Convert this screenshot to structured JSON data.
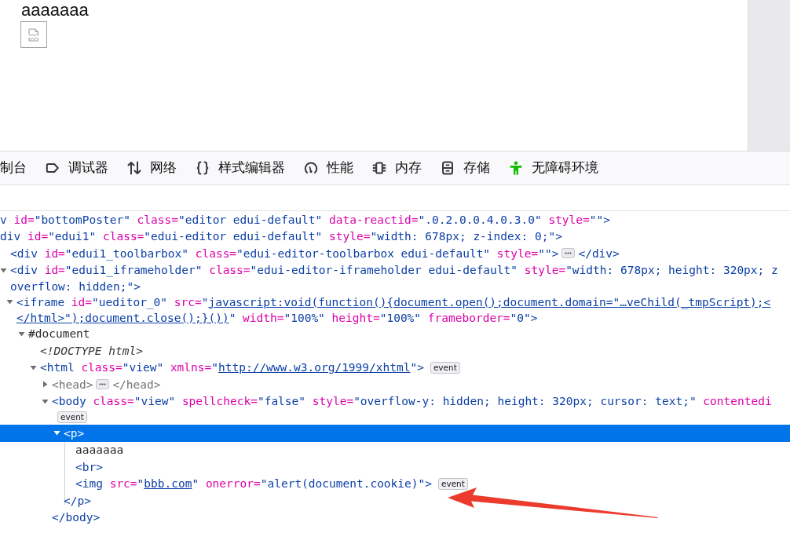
{
  "page_preview": {
    "paragraph": "aaaaaaa",
    "broken_image": true
  },
  "toolbar": {
    "tabs": [
      {
        "label": "制台",
        "selected": false
      },
      {
        "label": "调试器",
        "selected": false
      },
      {
        "label": "网络",
        "selected": false
      },
      {
        "label": "样式编辑器",
        "selected": false
      },
      {
        "label": "性能",
        "selected": false
      },
      {
        "label": "内存",
        "selected": false
      },
      {
        "label": "存储",
        "selected": false
      },
      {
        "label": "无障碍环境",
        "selected": false
      }
    ]
  },
  "tree": [
    {
      "selected": false,
      "lines": [
        [
          {
            "kind": "tag",
            "text": "v"
          },
          {
            "kind": "attr",
            "text": " id="
          },
          {
            "kind": "tag",
            "text": "\"bottomPoster\""
          },
          {
            "kind": "attr",
            "text": " class="
          },
          {
            "kind": "tag",
            "text": "\"editor edui-default\""
          },
          {
            "kind": "attr",
            "text": " data-reactid="
          },
          {
            "kind": "tag",
            "text": "\".0.2.0.0.4.0.3.0\""
          },
          {
            "kind": "attr",
            "text": " style="
          },
          {
            "kind": "tag",
            "text": "\"\">"
          }
        ]
      ],
      "children": [
        {
          "selected": false,
          "lines": [
            [
              {
                "kind": "tag",
                "text": "div"
              },
              {
                "kind": "attr",
                "text": " id="
              },
              {
                "kind": "tag",
                "text": "\"edui1\""
              },
              {
                "kind": "attr",
                "text": " class="
              },
              {
                "kind": "tag",
                "text": "\"edui-editor edui-default\""
              },
              {
                "kind": "attr",
                "text": " style="
              },
              {
                "kind": "tag",
                "text": "\"width: 678px; z-index: 0;\">"
              }
            ]
          ],
          "children": [
            {
              "selected": false,
              "lines": [
                [
                  {
                    "kind": "tag",
                    "text": "<div"
                  },
                  {
                    "kind": "attr",
                    "text": " id="
                  },
                  {
                    "kind": "tag",
                    "text": "\"edui1_toolbarbox\""
                  },
                  {
                    "kind": "attr",
                    "text": " class="
                  },
                  {
                    "kind": "tag",
                    "text": "\"edui-editor-toolbarbox edui-default\""
                  },
                  {
                    "kind": "attr",
                    "text": " style="
                  },
                  {
                    "kind": "tag",
                    "text": "\"\">"
                  },
                  {
                    "kind": "more"
                  },
                  {
                    "kind": "tag",
                    "text": "</div>"
                  }
                ]
              ]
            },
            {
              "selected": false,
              "expanded": true,
              "lines": [
                [
                  {
                    "kind": "tag",
                    "text": "<div"
                  },
                  {
                    "kind": "attr",
                    "text": " id="
                  },
                  {
                    "kind": "tag",
                    "text": "\"edui1_iframeholder\""
                  },
                  {
                    "kind": "attr",
                    "text": " class="
                  },
                  {
                    "kind": "tag",
                    "text": "\"edui-editor-iframeholder edui-default\""
                  },
                  {
                    "kind": "attr",
                    "text": " style="
                  },
                  {
                    "kind": "tag",
                    "text": "\"width: 678px; height: 320px; z"
                  }
                ],
                [
                  {
                    "kind": "tag",
                    "text": "overflow: hidden;\">"
                  }
                ]
              ],
              "children": [
                {
                  "selected": false,
                  "expanded": true,
                  "lines": [
                    [
                      {
                        "kind": "tag",
                        "text": "<iframe"
                      },
                      {
                        "kind": "attr",
                        "text": " id="
                      },
                      {
                        "kind": "tag",
                        "text": "\"ueditor_0\""
                      },
                      {
                        "kind": "attr",
                        "text": " src="
                      },
                      {
                        "kind": "tag",
                        "text": "\""
                      },
                      {
                        "kind": "link",
                        "text": "javascript:void(function(){document.open();document.domain=\"…veChild(_tmpScript);<"
                      }
                    ],
                    [
                      {
                        "kind": "link",
                        "text": "</html>\");document.close();}())"
                      },
                      {
                        "kind": "tag",
                        "text": "\""
                      },
                      {
                        "kind": "attr",
                        "text": " width="
                      },
                      {
                        "kind": "tag",
                        "text": "\"100%\""
                      },
                      {
                        "kind": "attr",
                        "text": " height="
                      },
                      {
                        "kind": "tag",
                        "text": "\"100%\""
                      },
                      {
                        "kind": "attr",
                        "text": " frameborder="
                      },
                      {
                        "kind": "tag",
                        "text": "\"0\">"
                      }
                    ]
                  ],
                  "children": [
                    {
                      "selected": false,
                      "expanded": true,
                      "lines": [
                        [
                          {
                            "kind": "text",
                            "text": "#document"
                          }
                        ]
                      ],
                      "children": [
                        {
                          "selected": false,
                          "lines": [
                            [
                              {
                                "kind": "doctype",
                                "text": "<!DOCTYPE html>"
                              }
                            ]
                          ]
                        },
                        {
                          "selected": false,
                          "expanded": true,
                          "lines": [
                            [
                              {
                                "kind": "tag",
                                "text": "<html"
                              },
                              {
                                "kind": "attr",
                                "text": " class="
                              },
                              {
                                "kind": "tag",
                                "text": "\"view\""
                              },
                              {
                                "kind": "attr",
                                "text": " xmlns="
                              },
                              {
                                "kind": "tag",
                                "text": "\""
                              },
                              {
                                "kind": "link",
                                "text": "http://www.w3.org/1999/xhtml"
                              },
                              {
                                "kind": "tag",
                                "text": "\">"
                              },
                              {
                                "kind": "badge",
                                "text": "event"
                              }
                            ]
                          ],
                          "children": [
                            {
                              "selected": false,
                              "expanded": false,
                              "lines": [
                                [
                                  {
                                    "kind": "muted",
                                    "text": "<head>"
                                  },
                                  {
                                    "kind": "more"
                                  },
                                  {
                                    "kind": "muted",
                                    "text": "</head>"
                                  }
                                ]
                              ]
                            },
                            {
                              "selected": false,
                              "expanded": true,
                              "lines": [
                                [
                                  {
                                    "kind": "tag",
                                    "text": "<body"
                                  },
                                  {
                                    "kind": "attr",
                                    "text": " class="
                                  },
                                  {
                                    "kind": "tag",
                                    "text": "\"view\""
                                  },
                                  {
                                    "kind": "attr",
                                    "text": " spellcheck="
                                  },
                                  {
                                    "kind": "tag",
                                    "text": "\"false\""
                                  },
                                  {
                                    "kind": "attr",
                                    "text": " style="
                                  },
                                  {
                                    "kind": "tag",
                                    "text": "\"overflow-y: hidden; height: 320px; cursor: text;\""
                                  },
                                  {
                                    "kind": "attr",
                                    "text": " contentedi"
                                  }
                                ],
                                [
                                  {
                                    "kind": "badge",
                                    "text": "event"
                                  }
                                ]
                              ],
                              "children": [
                                {
                                  "selected": true,
                                  "expanded": true,
                                  "lines": [
                                    [
                                      {
                                        "kind": "tag",
                                        "text": "<p>"
                                      }
                                    ]
                                  ],
                                  "children": [
                                    {
                                      "selected": false,
                                      "lines": [
                                        [
                                          {
                                            "kind": "text",
                                            "text": "aaaaaaa"
                                          }
                                        ]
                                      ]
                                    },
                                    {
                                      "selected": false,
                                      "lines": [
                                        [
                                          {
                                            "kind": "tag",
                                            "text": "<br>"
                                          }
                                        ]
                                      ]
                                    },
                                    {
                                      "selected": false,
                                      "lines": [
                                        [
                                          {
                                            "kind": "tag",
                                            "text": "<img"
                                          },
                                          {
                                            "kind": "attr",
                                            "text": " src="
                                          },
                                          {
                                            "kind": "tag",
                                            "text": "\""
                                          },
                                          {
                                            "kind": "link",
                                            "text": "bbb.com"
                                          },
                                          {
                                            "kind": "tag",
                                            "text": "\""
                                          },
                                          {
                                            "kind": "attr",
                                            "text": " onerror="
                                          },
                                          {
                                            "kind": "tag",
                                            "text": "\"alert(document.cookie)\">"
                                          },
                                          {
                                            "kind": "badge",
                                            "text": "event"
                                          }
                                        ]
                                      ]
                                    }
                                  ],
                                  "closing": [
                                    {
                                      "kind": "tag",
                                      "text": "</p>"
                                    }
                                  ]
                                }
                              ],
                              "closing": [
                                {
                                  "kind": "tag",
                                  "text": "</body>"
                                }
                              ]
                            }
                          ]
                        }
                      ]
                    }
                  ]
                }
              ]
            }
          ]
        }
      ]
    }
  ],
  "annotations": [
    {
      "kind": "arrow"
    }
  ]
}
